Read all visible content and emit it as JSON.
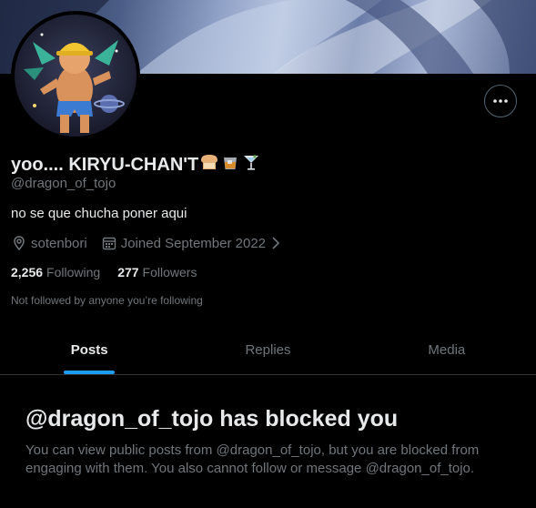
{
  "profile": {
    "display_name": "yoo.... KIRYU-CHAN'T",
    "display_name_emojis": [
      "bread-emoji",
      "whisky-glass-emoji",
      "cocktail-emoji"
    ],
    "handle": "@dragon_of_tojo",
    "bio": "no se que chucha poner aqui",
    "location": "sotenbori",
    "joined": "Joined September 2022",
    "following_count": "2,256",
    "following_label": "Following",
    "followers_count": "277",
    "followers_label": "Followers",
    "follow_note": "Not followed by anyone you’re following"
  },
  "header": {
    "more_icon": "more-horizontal-icon"
  },
  "tabs": [
    {
      "label": "Posts",
      "active": true
    },
    {
      "label": "Replies",
      "active": false
    },
    {
      "label": "Media",
      "active": false
    }
  ],
  "blocked": {
    "title": "@dragon_of_tojo has blocked you",
    "description": "You can view public posts from @dragon_of_tojo, but you are blocked from engaging with them. You also cannot follow or message @dragon_of_tojo."
  },
  "colors": {
    "background": "#000000",
    "text_primary": "#e7e9ea",
    "text_secondary": "#71767b",
    "accent": "#1d9bf0",
    "divider": "#2f3336"
  }
}
